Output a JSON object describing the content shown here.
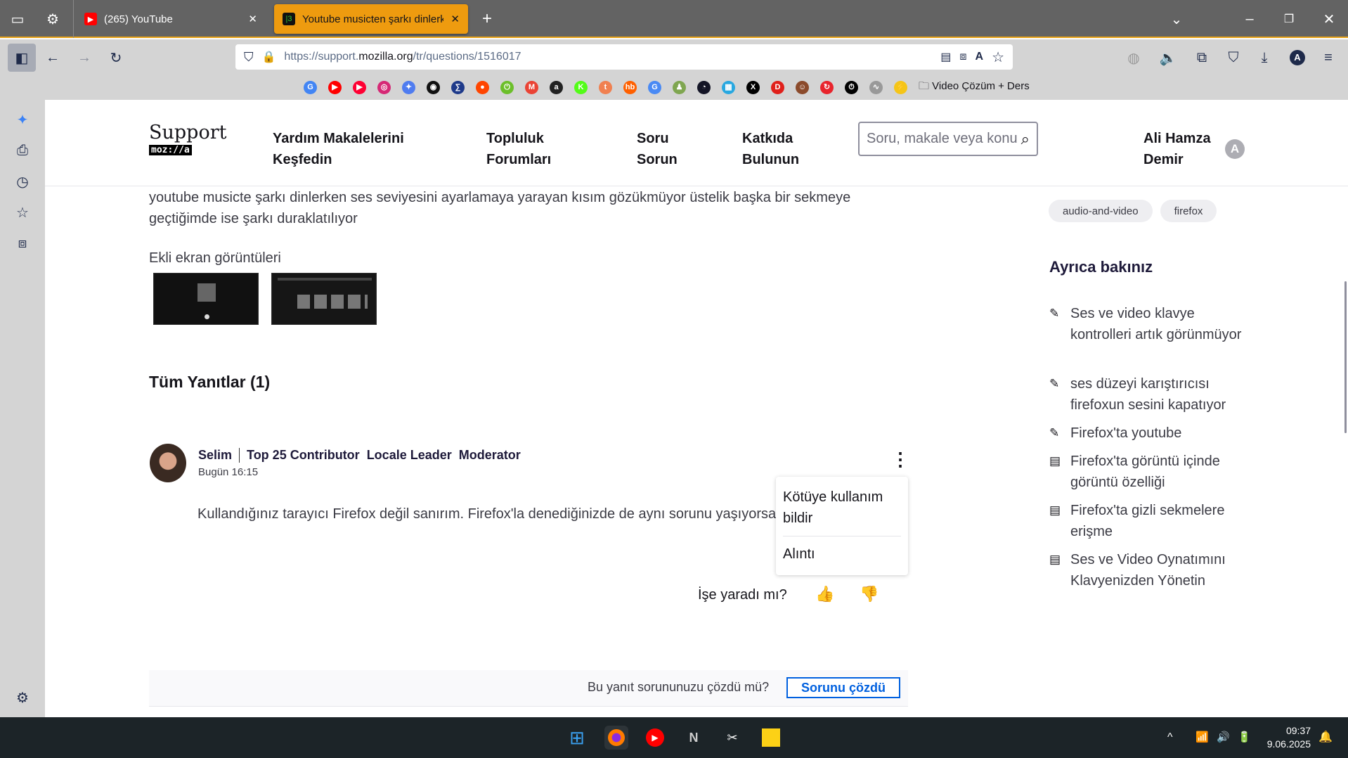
{
  "browser": {
    "tabs": [
      {
        "label": "(265) YouTube",
        "active": false
      },
      {
        "label": "Youtube musicten şarkı dinlerken",
        "active": true
      }
    ],
    "url_prefix": "https://support.",
    "url_domain": "mozilla.org",
    "url_path": "/tr/questions/1516017",
    "bookmarks": [
      {
        "name": "google",
        "letter": "G",
        "color": "#4285f4"
      },
      {
        "name": "youtube",
        "letter": "▶",
        "color": "#ff0000"
      },
      {
        "name": "youtube-music",
        "letter": "▶",
        "color": "#ff0033"
      },
      {
        "name": "instagram",
        "letter": "◎",
        "color": "#d62976"
      },
      {
        "name": "gemini",
        "letter": "✦",
        "color": "#4f7cf0"
      },
      {
        "name": "chatgpt",
        "letter": "◉",
        "color": "#111111"
      },
      {
        "name": "sigma",
        "letter": "∑",
        "color": "#1e3a8a"
      },
      {
        "name": "reddit",
        "letter": "●",
        "color": "#ff4500"
      },
      {
        "name": "power",
        "letter": "⏻",
        "color": "#6cbf2a"
      },
      {
        "name": "gmail",
        "letter": "M",
        "color": "#ea4335"
      },
      {
        "name": "amazon",
        "letter": "a",
        "color": "#222222"
      },
      {
        "name": "kick",
        "letter": "K",
        "color": "#53fc18"
      },
      {
        "name": "torrent",
        "letter": "t",
        "color": "#f08050"
      },
      {
        "name": "hepsiburada",
        "letter": "hb",
        "color": "#ff6000"
      },
      {
        "name": "translate",
        "letter": "G",
        "color": "#4a8af4"
      },
      {
        "name": "chess",
        "letter": "♟",
        "color": "#7fa650"
      },
      {
        "name": "speedtest",
        "letter": "◔",
        "color": "#141526"
      },
      {
        "name": "grid-app",
        "letter": "▦",
        "color": "#29a8e0"
      },
      {
        "name": "x",
        "letter": "X",
        "color": "#000000"
      },
      {
        "name": "d-app",
        "letter": "D",
        "color": "#e0201b"
      },
      {
        "name": "photo",
        "letter": "☺",
        "color": "#8b4a2b"
      },
      {
        "name": "refresh-app",
        "letter": "↻",
        "color": "#e8242c"
      },
      {
        "name": "timer",
        "letter": "⏱",
        "color": "#000000"
      },
      {
        "name": "audio",
        "letter": "∿",
        "color": "#999999"
      },
      {
        "name": "bolt",
        "letter": "⚡",
        "color": "#f5c518"
      }
    ],
    "bookmark_folder": "Video Çözüm + Ders"
  },
  "site": {
    "logo_text": "Support",
    "logo_sub": "moz://a",
    "nav": [
      {
        "l1": "Yardım Makalelerini",
        "l2": "Keşfedin"
      },
      {
        "l1": "Topluluk",
        "l2": "Forumları"
      },
      {
        "l1": "Soru",
        "l2": "Sorun"
      },
      {
        "l1": "Katkıda",
        "l2": "Bulunun"
      }
    ],
    "search_placeholder": "Soru, makale veya konu arayın (ö",
    "user": {
      "l1": "Ali Hamza",
      "l2": "Demir",
      "initial": "A"
    }
  },
  "question": {
    "text": "youtube musicte şarkı dinlerken ses seviyesini ayarlamaya yarayan kısım gözükmüyor üstelik başka bir sekmeye geçtiğimde ise şarkı duraklatılıyor",
    "attachments_label": "Ekli ekran görüntüleri"
  },
  "answers": {
    "heading": "Tüm Yanıtlar (1)",
    "items": [
      {
        "author": "Selim",
        "badges": [
          "Top 25 Contributor",
          "Locale Leader",
          "Moderator"
        ],
        "time": "Bugün 16:15",
        "body": "Kullandığınız tarayıcı Firefox değil sanırım. Firefox'la denediğinizde de aynı sorunu yaşıyorsanız yazabilirsiniz.",
        "helpful_label": "İşe yaradı mı?"
      }
    ],
    "menu": [
      "Kötüye kullanım bildir",
      "Alıntı"
    ],
    "solved_question": "Bu yanıt sorununuzu çözdü mü?",
    "solved_button": "Sorunu çözdü"
  },
  "sidebar_right": {
    "tags": [
      "audio-and-video",
      "firefox"
    ],
    "see_also_heading": "Ayrıca bakınız",
    "links": [
      {
        "icon": "edit-icon",
        "label": "Ses ve video klavye kontrolleri artık görünmüyor"
      },
      {
        "icon": "edit-icon",
        "label": "ses düzeyi karıştırıcısı firefoxun sesini kapatıyor"
      },
      {
        "icon": "edit-icon",
        "label": "Firefox'ta youtube"
      },
      {
        "icon": "article-icon",
        "label": "Firefox'ta görüntü içinde görüntü özelliği"
      },
      {
        "icon": "article-icon",
        "label": "Firefox'ta gizli sekmelere erişme"
      },
      {
        "icon": "article-icon",
        "label": "Ses ve Video Oynatımını Klavyenizden Yönetin"
      }
    ]
  },
  "taskbar": {
    "time": "09:37",
    "date": "9.06.2025"
  }
}
